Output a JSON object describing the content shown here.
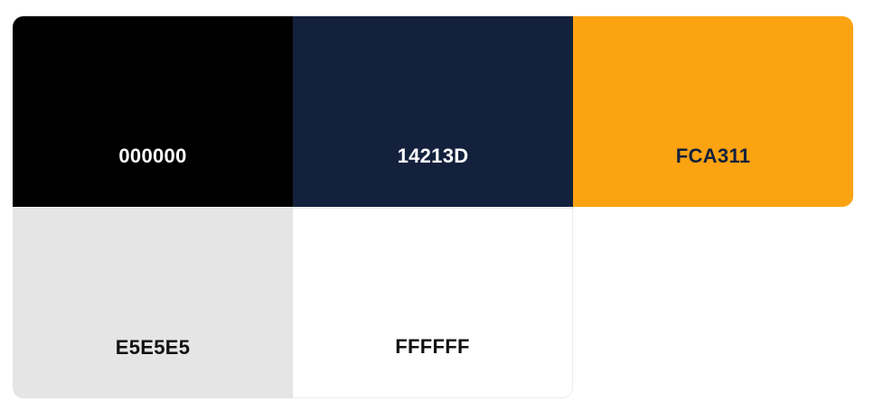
{
  "palette": {
    "swatches": [
      {
        "hex": "000000",
        "color": "#000000",
        "text_color": "#ffffff"
      },
      {
        "hex": "14213D",
        "color": "#14213D",
        "text_color": "#ffffff"
      },
      {
        "hex": "FCA311",
        "color": "#FCA311",
        "text_color": "#14213D"
      },
      {
        "hex": "E5E5E5",
        "color": "#E5E5E5",
        "text_color": "#111111"
      },
      {
        "hex": "FFFFFF",
        "color": "#FFFFFF",
        "text_color": "#111111"
      }
    ]
  }
}
